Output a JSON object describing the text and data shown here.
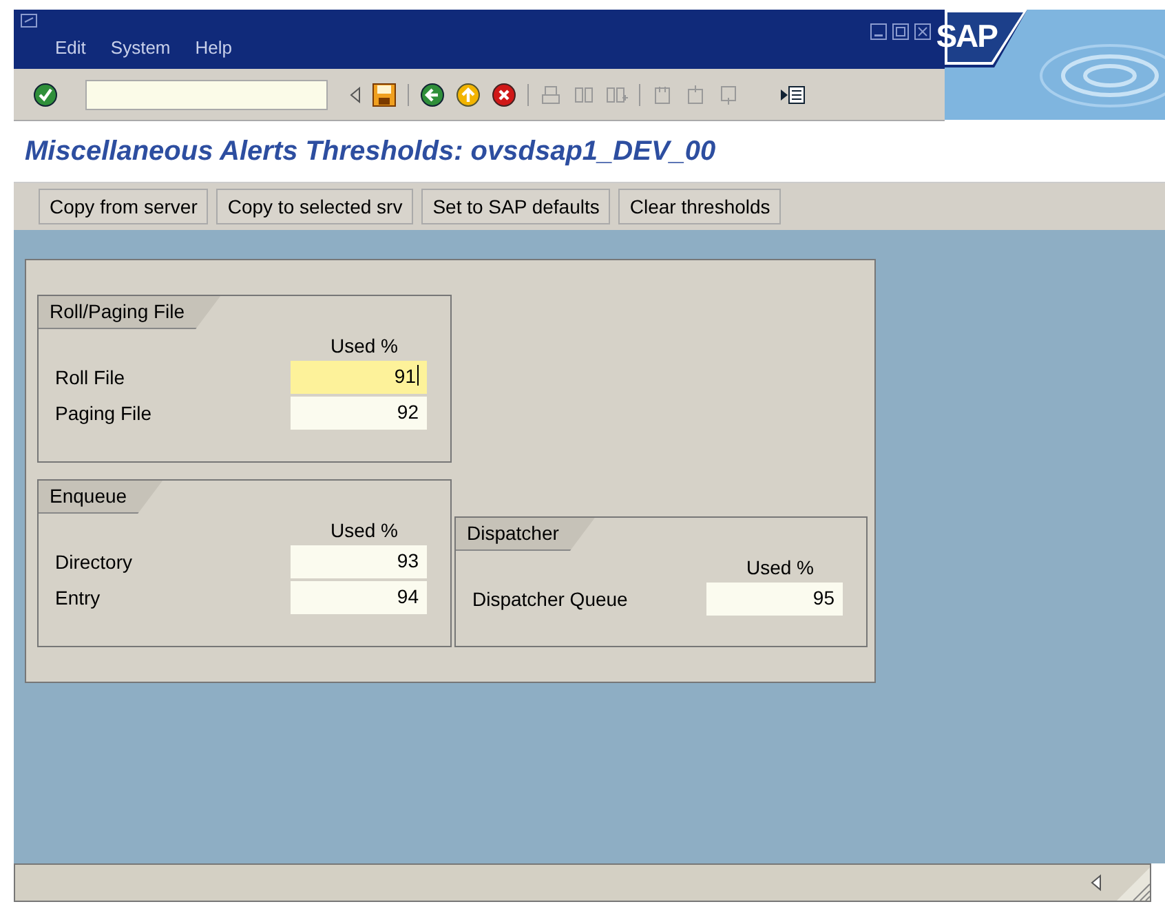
{
  "logo": "SAP",
  "menu": [
    "Edit",
    "System",
    "Help"
  ],
  "title": "Miscellaneous Alerts Thresholds: ovsdsap1_DEV_00",
  "buttons": [
    "Copy from server",
    "Copy to selected srv",
    "Set to SAP defaults",
    "Clear thresholds"
  ],
  "groups": [
    {
      "title": "Roll/Paging File",
      "header": "Used %",
      "rows": [
        {
          "label": "Roll File",
          "value": "91",
          "focused": true
        },
        {
          "label": "Paging File",
          "value": "92",
          "focused": false
        }
      ]
    },
    {
      "title": "Enqueue",
      "header": "Used %",
      "rows": [
        {
          "label": "Directory",
          "value": "93",
          "focused": false
        },
        {
          "label": "Entry",
          "value": "94",
          "focused": false
        }
      ]
    },
    {
      "title": "Dispatcher",
      "header": "Used %",
      "rows": [
        {
          "label": "Dispatcher Queue",
          "value": "95",
          "focused": false
        }
      ]
    }
  ]
}
